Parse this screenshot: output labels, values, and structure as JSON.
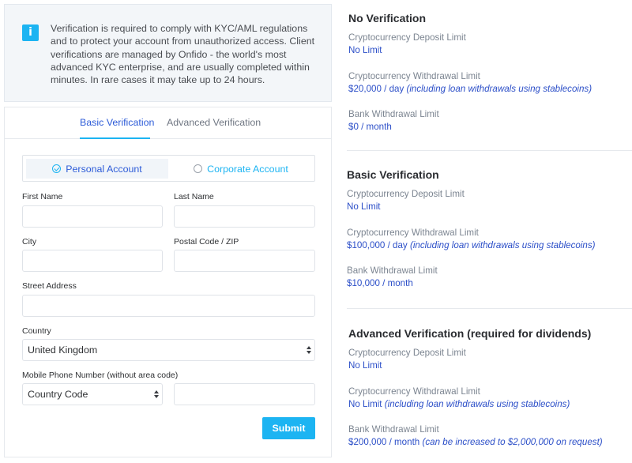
{
  "notice": {
    "icon": "info-icon",
    "icon_glyph": "i",
    "text": "Verification is required to comply with KYC/AML regulations and to protect your account from unauthorized access. Client verifications are managed by Onfido - the world's most advanced KYC enterprise, and are usually completed within minutes. In rare cases it may take up to 24 hours."
  },
  "tabs": [
    {
      "label": "Basic Verification",
      "active": true
    },
    {
      "label": "Advanced Verification",
      "active": false
    }
  ],
  "account_type": {
    "options": [
      {
        "label": "Personal Account",
        "selected": true
      },
      {
        "label": "Corporate Account",
        "selected": false
      }
    ]
  },
  "form": {
    "first_name": {
      "label": "First Name",
      "value": ""
    },
    "last_name": {
      "label": "Last Name",
      "value": ""
    },
    "city": {
      "label": "City",
      "value": ""
    },
    "postal_code": {
      "label": "Postal Code / ZIP",
      "value": ""
    },
    "street_address": {
      "label": "Street Address",
      "value": ""
    },
    "country": {
      "label": "Country",
      "value": "United Kingdom"
    },
    "phone": {
      "label": "Mobile Phone Number (without area code)",
      "country_code": "Country Code",
      "value": ""
    },
    "submit_label": "Submit"
  },
  "limits": [
    {
      "title": "No Verification",
      "items": [
        {
          "label": "Cryptocurrency Deposit Limit",
          "value": "No Limit",
          "note": ""
        },
        {
          "label": "Cryptocurrency Withdrawal Limit",
          "value": "$20,000 / day",
          "note": "(including loan withdrawals using stablecoins)"
        },
        {
          "label": "Bank Withdrawal Limit",
          "value": "$0 / month",
          "note": ""
        }
      ]
    },
    {
      "title": "Basic Verification",
      "items": [
        {
          "label": "Cryptocurrency Deposit Limit",
          "value": "No Limit",
          "note": ""
        },
        {
          "label": "Cryptocurrency Withdrawal Limit",
          "value": "$100,000 / day",
          "note": "(including loan withdrawals using stablecoins)"
        },
        {
          "label": "Bank Withdrawal Limit",
          "value": "$10,000 / month",
          "note": ""
        }
      ]
    },
    {
      "title": "Advanced Verification (required for dividends)",
      "items": [
        {
          "label": "Cryptocurrency Deposit Limit",
          "value": "No Limit",
          "note": ""
        },
        {
          "label": "Cryptocurrency Withdrawal Limit",
          "value": "No Limit",
          "note": "(including loan withdrawals using stablecoins)"
        },
        {
          "label": "Bank Withdrawal Limit",
          "value": "$200,000 / month",
          "note": "(can be increased to $2,000,000 on request)"
        }
      ]
    }
  ],
  "colors": {
    "accent": "#1cb4f2",
    "link_blue": "#2c4fc8",
    "active_tab": "#2c5bd8"
  }
}
